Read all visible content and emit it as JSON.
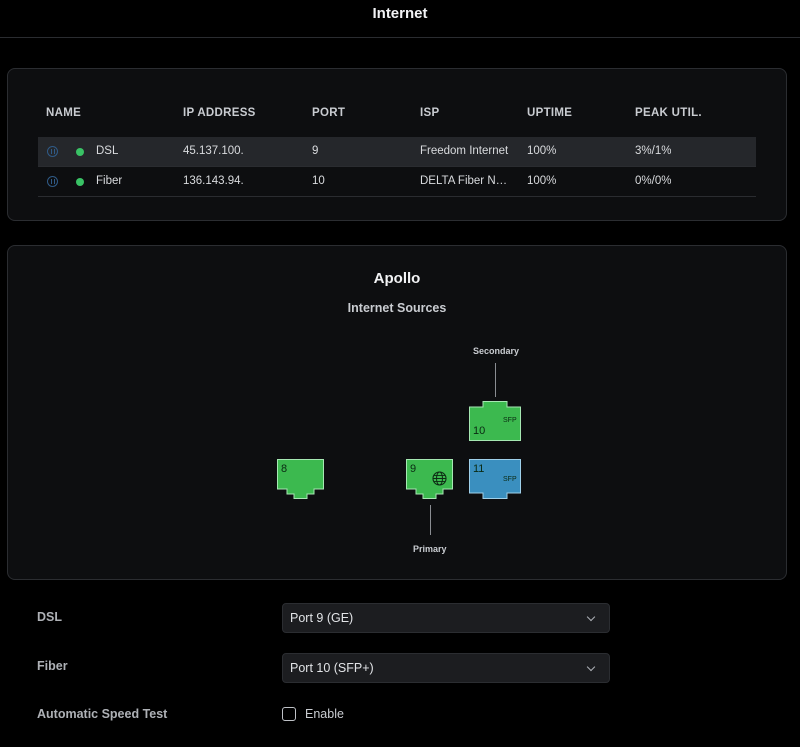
{
  "page": {
    "title": "Internet"
  },
  "wan_table": {
    "columns": [
      "NAME",
      "IP ADDRESS",
      "PORT",
      "ISP",
      "UPTIME",
      "PEAK UTIL."
    ],
    "rows": [
      {
        "name": "DSL",
        "ip": "45.137.100.",
        "port": "9",
        "isp": "Freedom Internet",
        "uptime": "100%",
        "peak": "3%/1%",
        "status": "online",
        "selected": true
      },
      {
        "name": "Fiber",
        "ip": "136.143.94.",
        "port": "10",
        "isp": "DELTA Fiber Nederland",
        "uptime": "100%",
        "peak": "0%/0%",
        "status": "online",
        "selected": false
      }
    ]
  },
  "topology": {
    "device_name": "Apollo",
    "subtitle": "Internet Sources",
    "ports": [
      {
        "number": "8",
        "type": "",
        "color": "#3cb94f",
        "icon": ""
      },
      {
        "number": "9",
        "type": "",
        "color": "#3cb94f",
        "icon": "globe-icon"
      },
      {
        "number": "10",
        "type": "SFP",
        "color": "#3cb94f",
        "icon": ""
      },
      {
        "number": "11",
        "type": "SFP",
        "color": "#3a8fbf",
        "icon": ""
      }
    ],
    "primary_label": "Primary",
    "secondary_label": "Secondary"
  },
  "settings": {
    "dsl": {
      "label": "DSL",
      "value": "Port 9 (GE)"
    },
    "fiber": {
      "label": "Fiber",
      "value": "Port 10 (SFP+)"
    },
    "speed_test": {
      "label": "Automatic Speed Test",
      "checkbox_label": "Enable",
      "checked": false
    }
  },
  "colors": {
    "background": "#000000",
    "card": "#0d0e10",
    "status_online": "#39c265",
    "port_active": "#3cb94f",
    "port_sfp_blue": "#3a8fbf"
  }
}
